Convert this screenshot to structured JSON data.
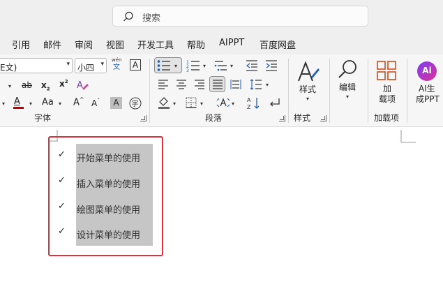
{
  "search": {
    "label": "搜索"
  },
  "menu": [
    "引用",
    "邮件",
    "审阅",
    "视图",
    "开发工具",
    "帮助",
    "AIPPT",
    "百度网盘"
  ],
  "ribbon": {
    "font_group": {
      "font_name": "E文)",
      "font_size": "小四",
      "phonetic_top": "wén",
      "phonetic_bottom": "文",
      "border_char": "A",
      "strike": "ab",
      "subscript": "x",
      "subscript_mark": "2",
      "superscript": "x",
      "superscript_mark": "2",
      "font_color": "A",
      "aa": "Aa",
      "grow": "A",
      "shrink": "A",
      "shade": "A",
      "circle_char": "字",
      "label": "字体"
    },
    "paragraph_group": {
      "label": "段落"
    },
    "styles_group": {
      "button": "样式",
      "label": "样式"
    },
    "editing": {
      "button": "编辑"
    },
    "addins_group": {
      "button_line1": "加",
      "button_line2": "载项",
      "label": "加载项"
    },
    "ai": {
      "line1": "AI生",
      "line2": "成PPT",
      "badge": "Ai"
    }
  },
  "document": {
    "items": [
      "开始菜单的使用",
      "插入菜单的使用",
      "绘图菜单的使用",
      "设计菜单的使用"
    ],
    "check": "✓"
  },
  "colors": {
    "red_box": "#e0303a",
    "highlight": "#c6c6c6",
    "font_color_bar": "#c00000",
    "accent_orange": "#d04a1a"
  }
}
